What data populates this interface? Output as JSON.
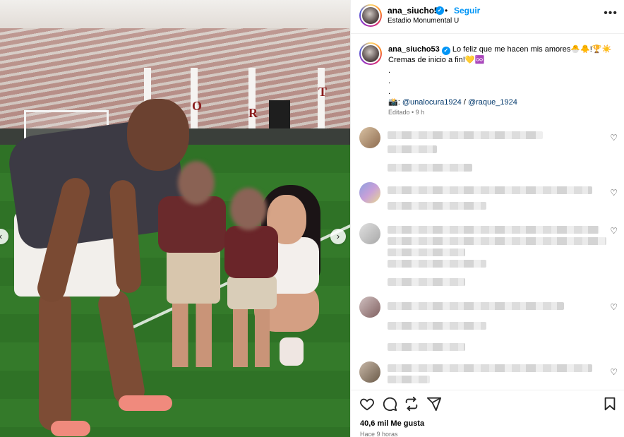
{
  "post": {
    "username": "ana_siucho53",
    "verified": true,
    "follow_label": "Seguir",
    "separator": "•",
    "location": "Estadio Monumental U",
    "more_label": "•••",
    "photo": {
      "carousel_prev": "‹",
      "carousel_next": "›",
      "stadium_letters": [
        "O",
        "R",
        "T"
      ]
    }
  },
  "caption": {
    "username": "ana_siucho53",
    "text": "Lo feliz que me hacen mis amores🐣🐥!🏆☀️",
    "line2": "Cremas de inicio a fin!💛♾️",
    "dots": [
      ".",
      ".",
      "."
    ],
    "credits_prefix": "📸:",
    "mention1": "@unalocura1924",
    "credits_sep": "/",
    "mention2": "@raque_1924",
    "edited": "Editado • 9 h"
  },
  "comments": {
    "heart_icon": "♡"
  },
  "actions": {
    "likes": "40,6 mil Me gusta",
    "time": "Hace 9 horas"
  },
  "colors": {
    "accent": "#0095f6",
    "mention": "#00376b",
    "muted": "#737373"
  }
}
